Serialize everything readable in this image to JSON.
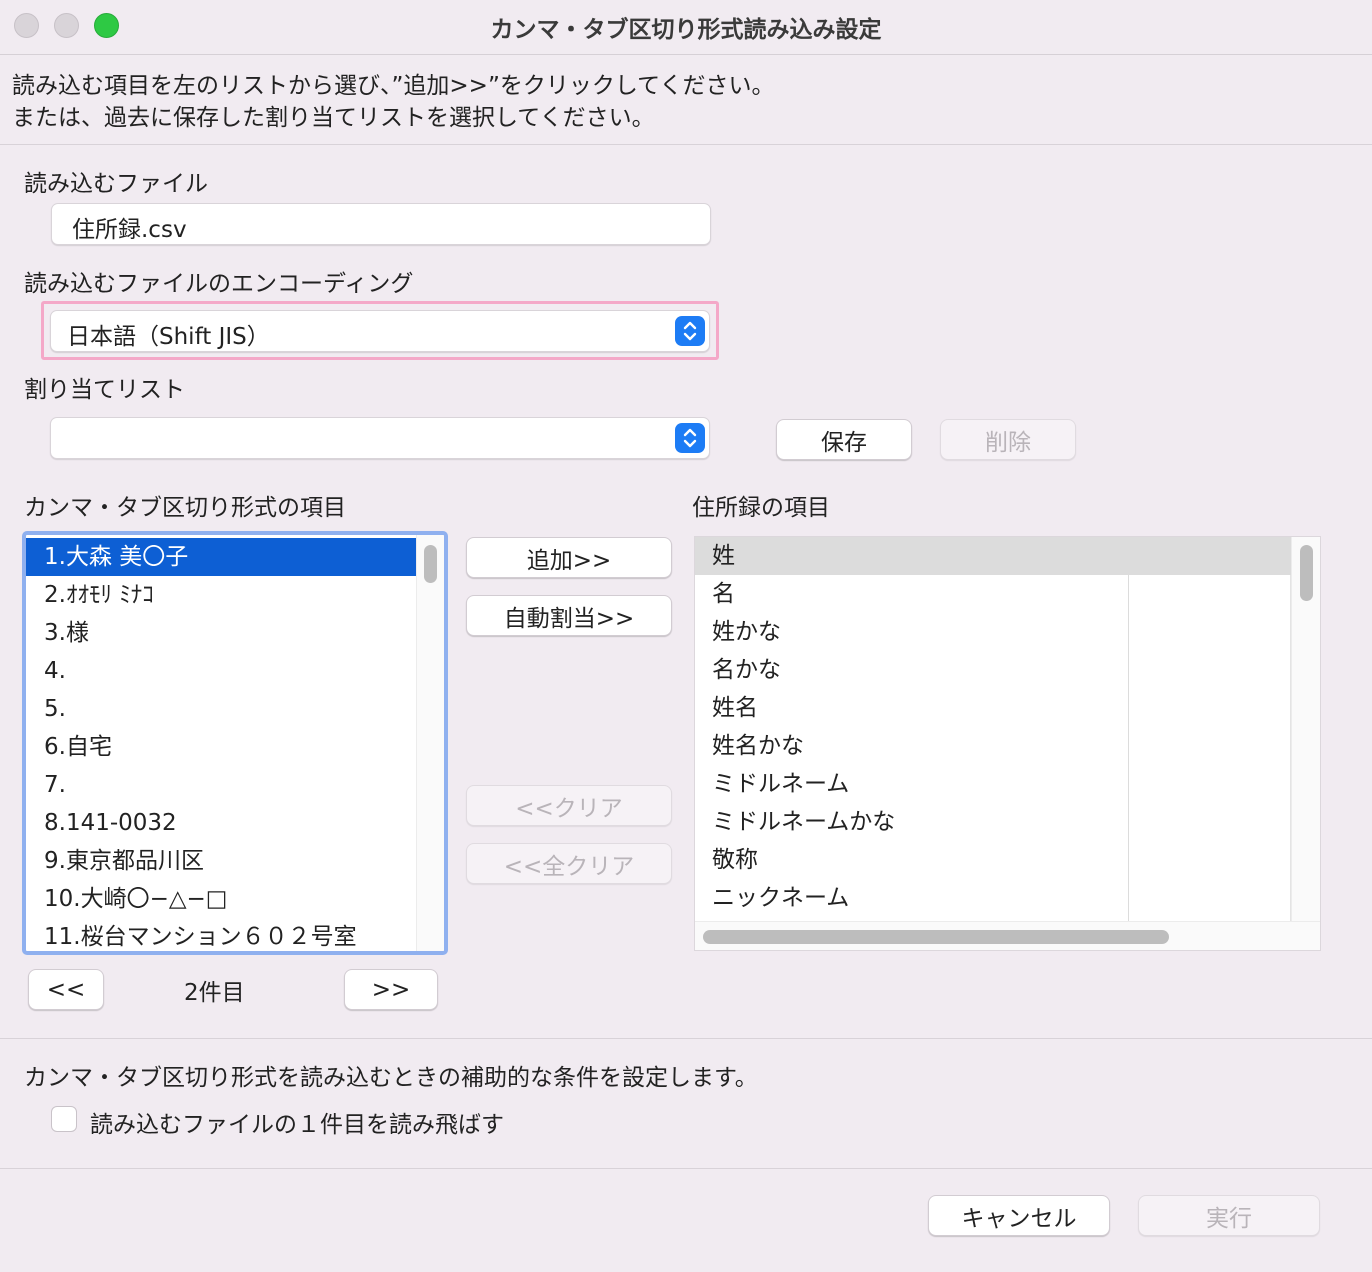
{
  "window": {
    "title": "カンマ・タブ区切り形式読み込み設定"
  },
  "intro": {
    "line1": "読み込む項目を左のリストから選び、”追加>>”をクリックしてください。",
    "line2": "または、過去に保存した割り当てリストを選択してください。"
  },
  "file": {
    "label": "読み込むファイル",
    "value": "住所録.csv"
  },
  "encoding": {
    "label": "読み込むファイルのエンコーディング",
    "value": "日本語（Shift JIS）"
  },
  "assignment": {
    "label": "割り当てリスト",
    "value": "",
    "save_label": "保存",
    "delete_label": "削除"
  },
  "left_list": {
    "label": "カンマ・タブ区切り形式の項目",
    "items": [
      "1.大森 美〇子",
      "2.ｵｵﾓﾘ ﾐﾅｺ",
      "3.様",
      "4.",
      "5.",
      "6.自宅",
      "7.",
      "8.141-0032",
      "9.東京都品川区",
      "10.大崎〇−△−□",
      "11.桜台マンション６０２号室"
    ],
    "selected_index": 0
  },
  "middle_buttons": {
    "add": "追加>>",
    "auto_assign": "自動割当>>",
    "clear": "<<クリア",
    "clear_all": "<<全クリア"
  },
  "pager": {
    "prev": "<<",
    "record": "2件目",
    "next": ">>"
  },
  "right_list": {
    "label": "住所録の項目",
    "items": [
      "姓",
      "名",
      "姓かな",
      "名かな",
      "姓名",
      "姓名かな",
      "ミドルネーム",
      "ミドルネームかな",
      "敬称",
      "ニックネーム"
    ],
    "highlighted_index": 0
  },
  "options": {
    "description": "カンマ・タブ区切り形式を読み込むときの補助的な条件を設定します。",
    "skip_first_label": "読み込むファイルの１件目を読み飛ばす",
    "skip_first_checked": false
  },
  "footer": {
    "cancel": "キャンセル",
    "run": "実行"
  },
  "colors": {
    "accent": "#1d7cf5",
    "selection": "#0d5fd4",
    "highlight_border": "#f4a8c8",
    "list_focus": "#8fb0ef"
  }
}
